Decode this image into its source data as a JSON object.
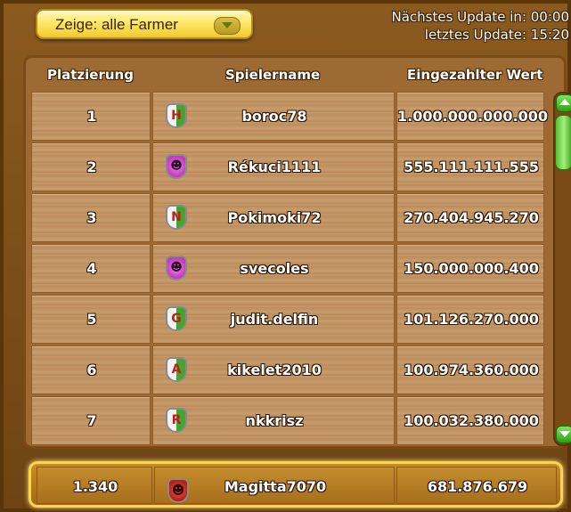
{
  "filter": {
    "label": "Zeige: alle Farmer"
  },
  "update": {
    "next": "Nächstes Update in: 00:00",
    "last": "letztes Update: 15:20"
  },
  "columns": {
    "rank": "Platzierung",
    "player": "Spielername",
    "value": "Eingezahlter Wert"
  },
  "rows": [
    {
      "rank": "1",
      "crest": "H",
      "player": "boroc78",
      "value": "1.000.000.000.000"
    },
    {
      "rank": "2",
      "crest": "",
      "player": "Rékuci1111",
      "value": "555.111.111.555"
    },
    {
      "rank": "3",
      "crest": "N",
      "player": "Pokimoki72",
      "value": "270.404.945.270"
    },
    {
      "rank": "4",
      "crest": "",
      "player": "svecoles",
      "value": "150.000.000.400"
    },
    {
      "rank": "5",
      "crest": "G",
      "player": "judit.delfin",
      "value": "101.126.270.000"
    },
    {
      "rank": "6",
      "crest": "A",
      "player": "kikelet2010",
      "value": "100.974.360.000"
    },
    {
      "rank": "7",
      "crest": "R",
      "player": "nkkrisz",
      "value": "100.032.380.000"
    }
  ],
  "own": {
    "rank": "1.340",
    "player": "Magitta7070",
    "value": "681.876.679"
  },
  "colors": {
    "accent": "#fde86a",
    "wood": "#c79a6a",
    "scroll": "#43a52e"
  }
}
